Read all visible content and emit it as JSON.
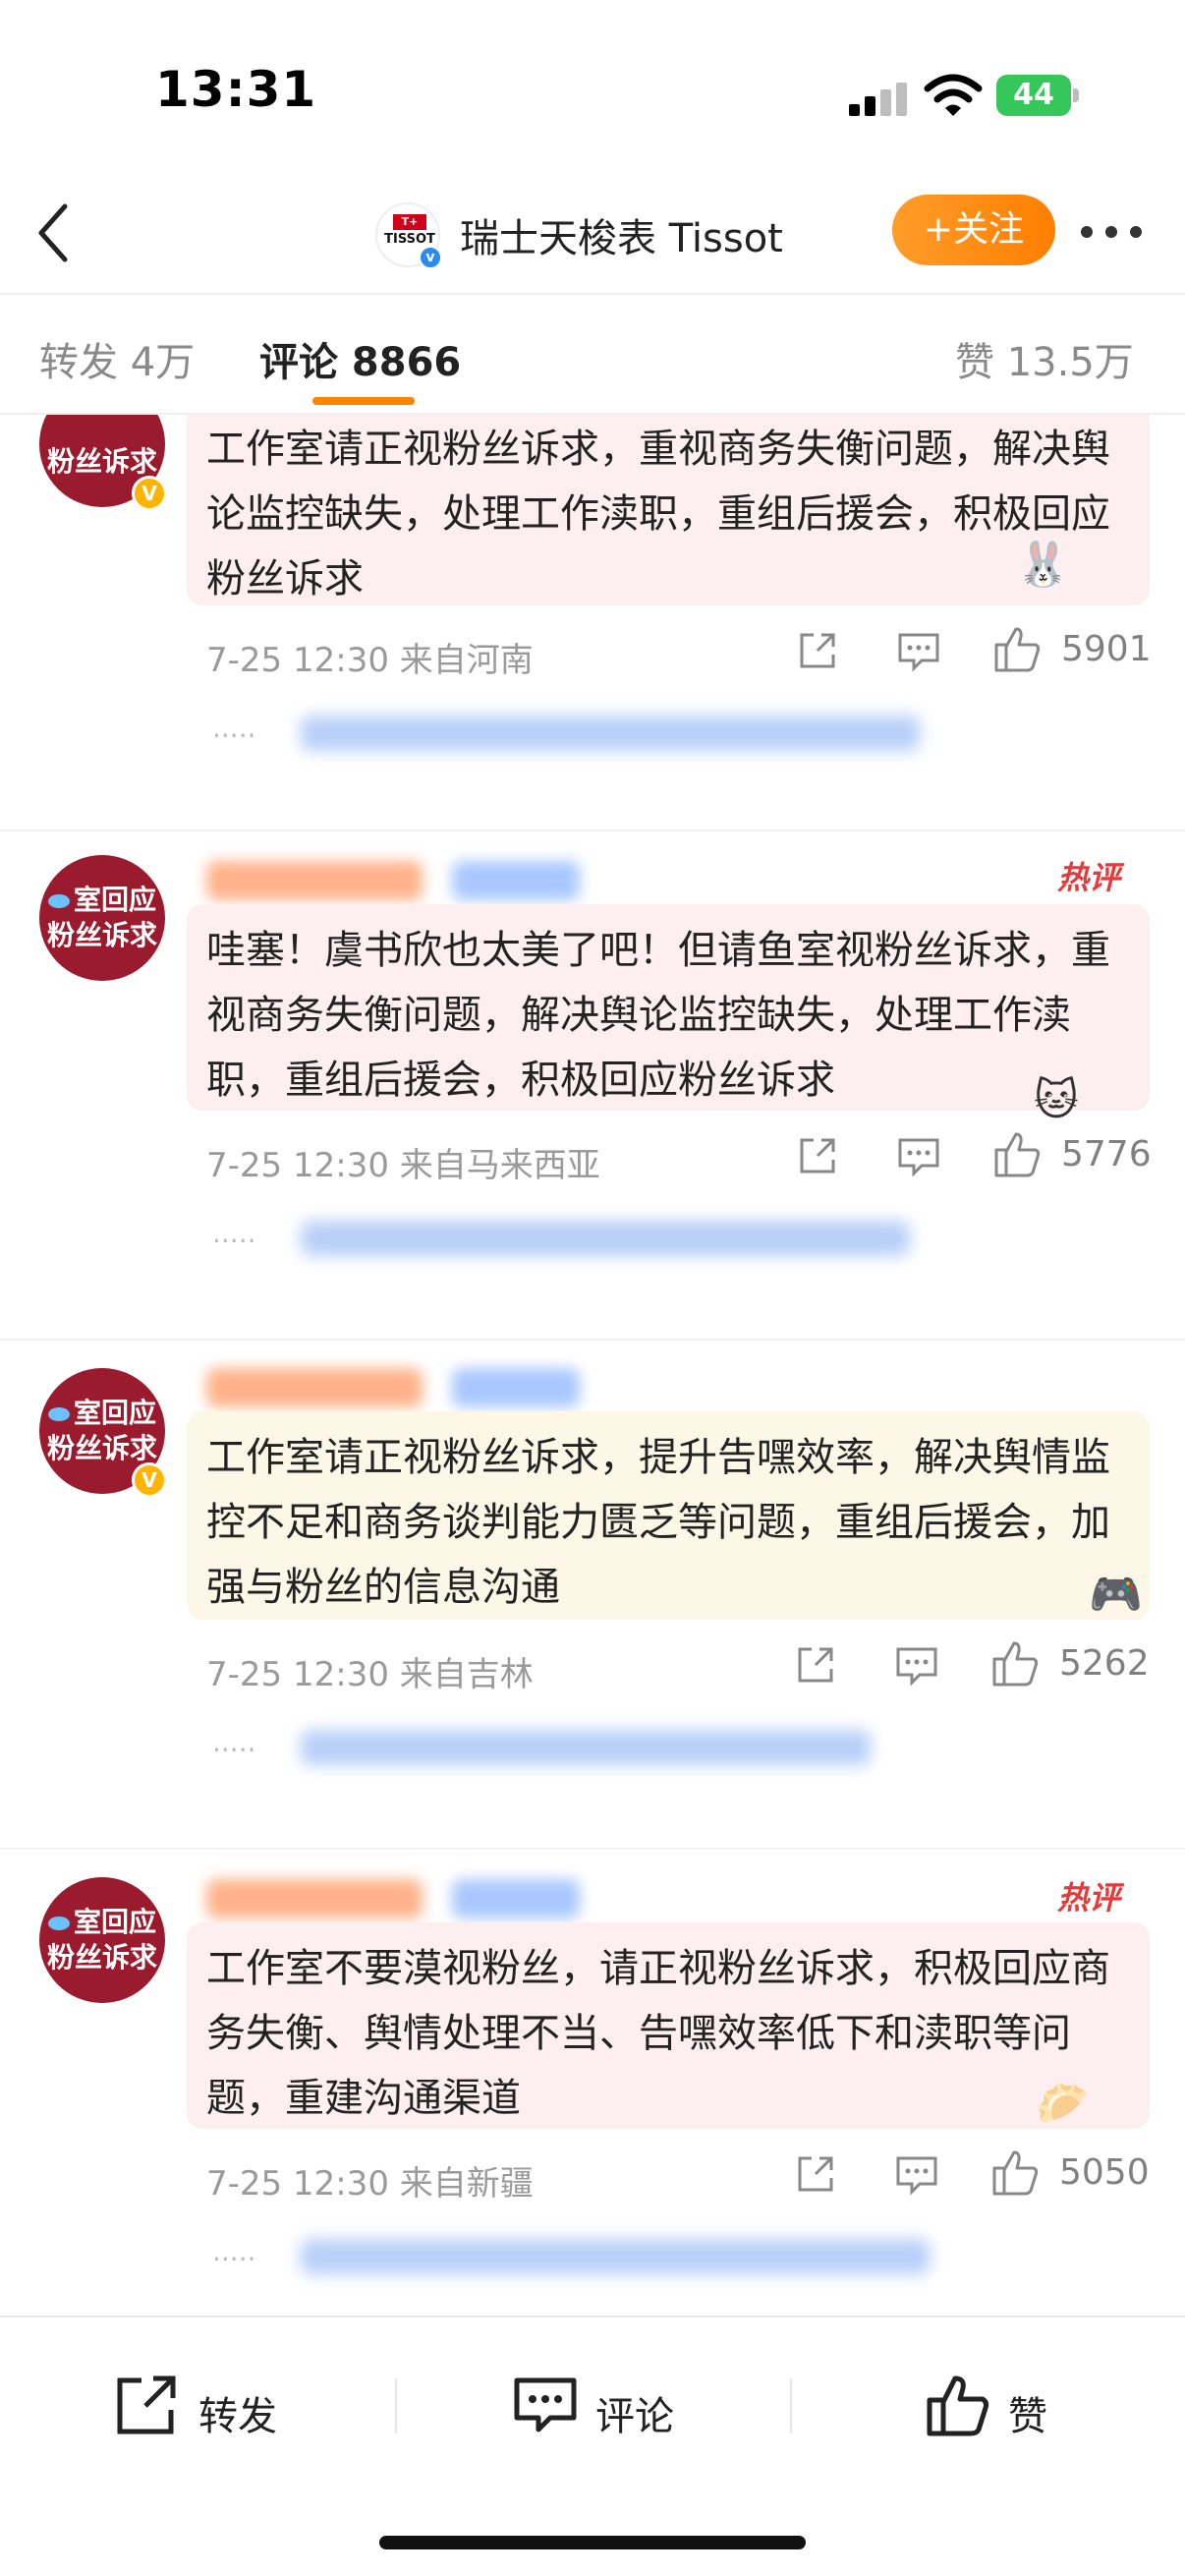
{
  "status_bar": {
    "time": "13:31",
    "battery": "44"
  },
  "header": {
    "account_name": "瑞士天梭表 Tissot",
    "follow_label": "+关注",
    "avatar_logo_text": "TISSOT"
  },
  "tabs": {
    "repost": "转发 4万",
    "comments": "评论 8866",
    "likes": "赞 13.5万"
  },
  "comments": [
    {
      "avatar_line1": "",
      "avatar_line2": "粉丝诉求",
      "text": "工作室请正视粉丝诉求，重视商务失衡问题，解决舆论监控缺失，处理工作渎职，重组后援会，积极回应粉丝诉求",
      "time": "7-25 12:30",
      "location": "来自河南",
      "likes": "5901",
      "hot": false
    },
    {
      "avatar_line1": "室回应",
      "avatar_line2": "粉丝诉求",
      "text": "哇塞！虞书欣也太美了吧！但请鱼室视粉丝诉求，重视商务失衡问题，解决舆论监控缺失，处理工作渎职，重组后援会，积极回应粉丝诉求",
      "time": "7-25 12:30",
      "location": "来自马来西亚",
      "likes": "5776",
      "hot": true,
      "hot_label": "热评"
    },
    {
      "avatar_line1": "室回应",
      "avatar_line2": "粉丝诉求",
      "text": "工作室请正视粉丝诉求，提升告嘿效率，解决舆情监控不足和商务谈判能力匮乏等问题，重组后援会，加强与粉丝的信息沟通",
      "time": "7-25 12:30",
      "location": "来自吉林",
      "likes": "5262",
      "hot": false
    },
    {
      "avatar_line1": "室回应",
      "avatar_line2": "粉丝诉求",
      "text": "工作室不要漠视粉丝，请正视粉丝诉求，积极回应商务失衡、舆情处理不当、告嘿效率低下和渎职等问题，重建沟通渠道",
      "time": "7-25 12:30",
      "location": "来自新疆",
      "likes": "5050",
      "hot": true,
      "hot_label": "热评"
    }
  ],
  "bottom_bar": {
    "repost": "转发",
    "comment": "评论",
    "like": "赞"
  },
  "colors": {
    "accent_orange": "#ff8200",
    "avatar_red": "#9b1b2e",
    "hot_red": "#e63a3a",
    "bubble_pink": "#fdeef0",
    "bubble_yellow": "#fcf7e6"
  }
}
